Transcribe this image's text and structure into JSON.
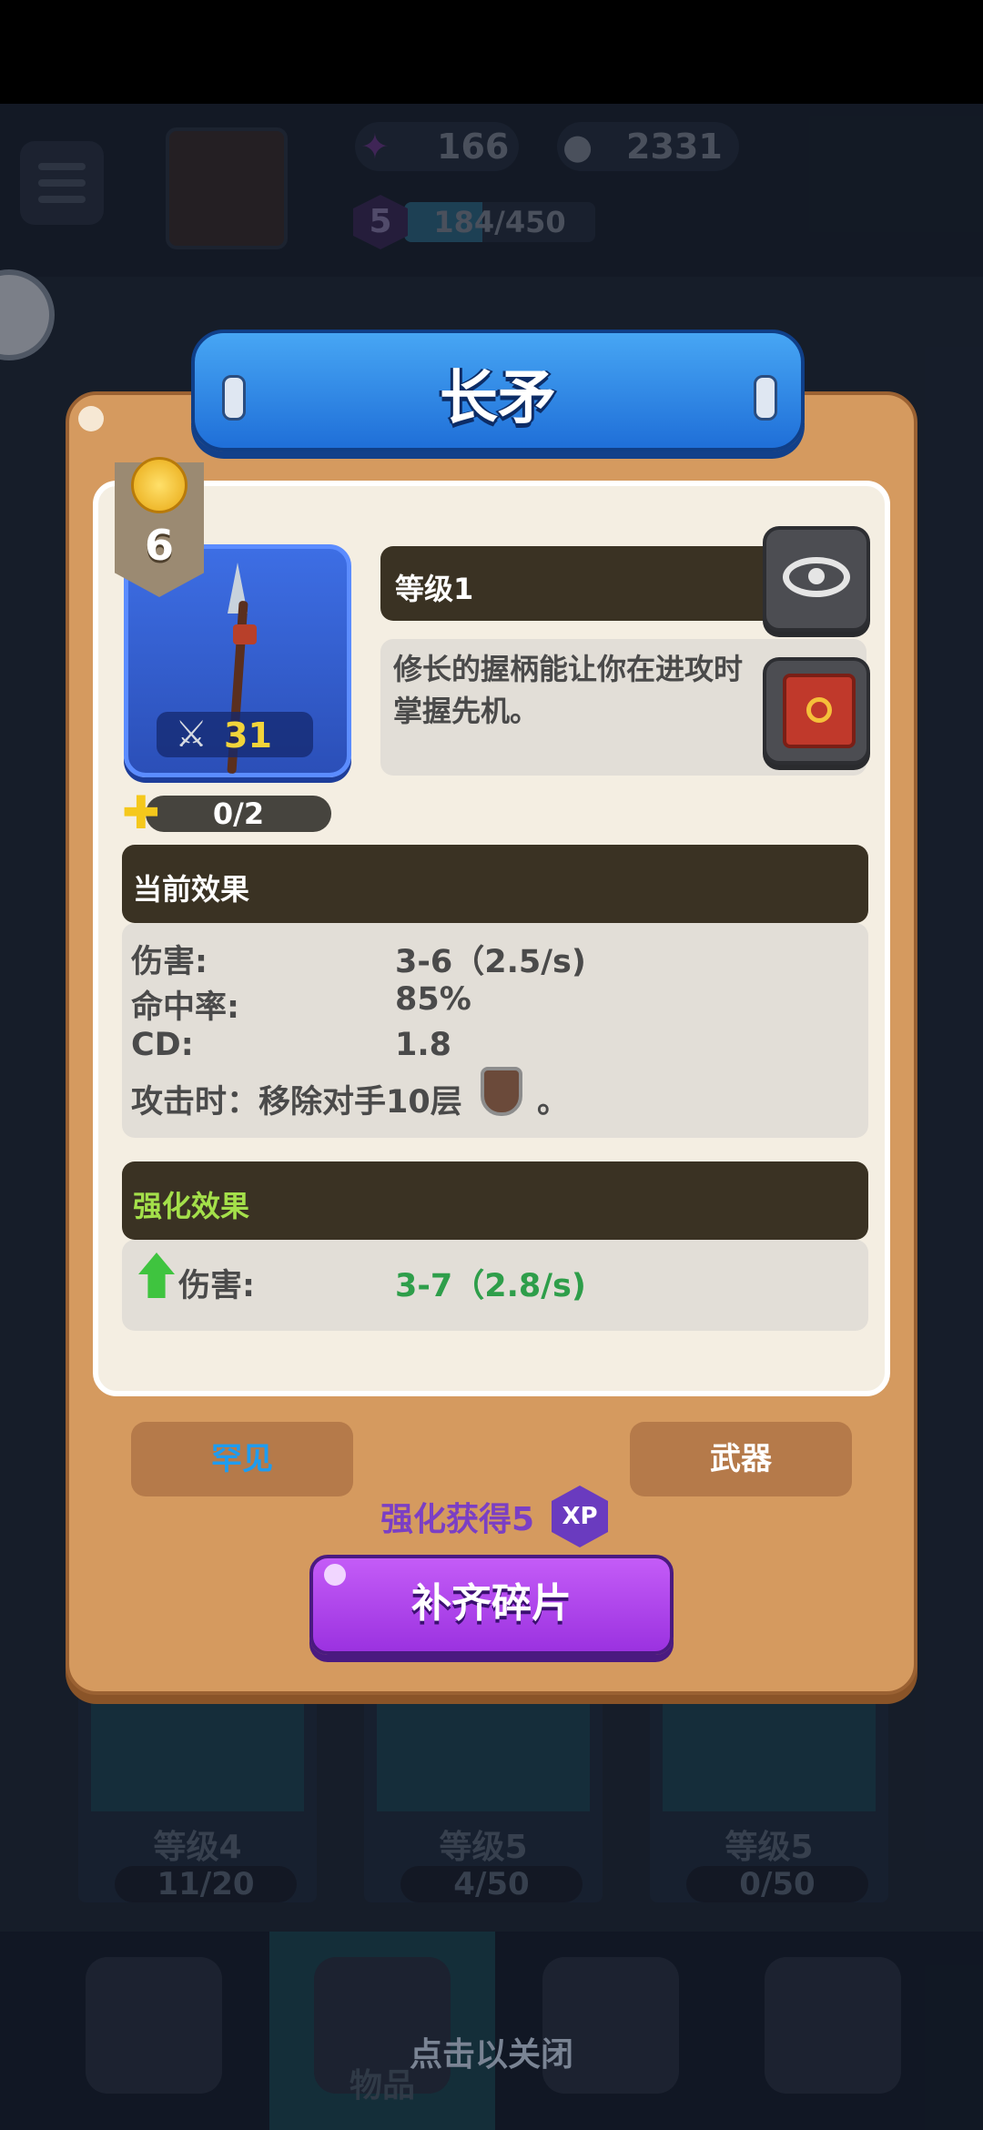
{
  "hud": {
    "gems": "166",
    "coins": "2331",
    "player_level": "5",
    "xp_progress": "184/450",
    "xp_fraction": 0.41
  },
  "modal": {
    "title": "长矛",
    "rarity_value": "6",
    "power": "31",
    "fragments": "0/2",
    "level_label": "等级1",
    "description": "修长的握柄能让你在进攻时掌握先机。",
    "current_effects": {
      "header": "当前效果",
      "stats": [
        {
          "label": "伤害:",
          "value": "3-6（2.5/s)"
        },
        {
          "label": "命中率:",
          "value": "85%"
        },
        {
          "label": "CD:",
          "value": "1.8"
        }
      ],
      "on_attack_prefix": "攻击时：移除对手10层",
      "on_attack_suffix": "。"
    },
    "upgrade_effects": {
      "header": "强化效果",
      "stat_label": "伤害:",
      "stat_value": "3-7（2.8/s)"
    },
    "rarity_tag": "罕见",
    "type_tag": "武器",
    "xp_reward": "强化获得5",
    "xp_badge": "XP",
    "action_button": "补齐碎片"
  },
  "background_cards": [
    {
      "level": "等级4",
      "progress": "11/20"
    },
    {
      "level": "等级5",
      "progress": "4/50"
    },
    {
      "level": "等级5",
      "progress": "0/50"
    }
  ],
  "nav": {
    "active_label": "物品"
  },
  "close_hint": "点击以关闭",
  "colors": {
    "rarity_tag_text": "#1e9cf0",
    "upgrade_value": "#2e9e4a",
    "upgrade_header": "#a4e04a",
    "xp_purple": "#7b3fc4"
  }
}
